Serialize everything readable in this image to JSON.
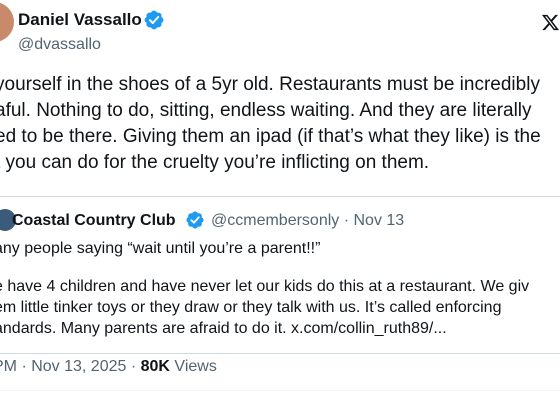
{
  "author": {
    "name": "Daniel Vassallo",
    "handle": "@dvassallo"
  },
  "post": {
    "lines": [
      " yourself in the shoes of a 5yr old. Restaurants must be incredibly",
      "aful. Nothing to do, sitting, endless waiting. And they are literally",
      "ed to be there. Giving them an ipad (if that’s what they like) is the",
      "t you can do for the cruelty you’re inflicting on them."
    ]
  },
  "quote": {
    "name": "Coastal Country Club",
    "handle": "@ccmembersonly · Nov 13",
    "lines": [
      "any people saying “wait until you’re a parent!!”",
      "",
      "e have 4 children and have never let our kids do this at a restaurant.  We giv",
      "em little tinker toys or they draw or they talk with us.  It’s called enforcing",
      "andards.  Many parents are afraid to do it. x.com/collin_ruth89/..."
    ]
  },
  "meta": {
    "time_date": " PM · Nov 13, 2025 · ",
    "views_count": "80K",
    "views_label": " Views"
  },
  "icons": {
    "verified": "verified-badge-icon",
    "logo": "x-logo-icon"
  },
  "colors": {
    "verified": "#1d9bf0",
    "secondary_text": "#536471",
    "border": "#cfd9de"
  }
}
